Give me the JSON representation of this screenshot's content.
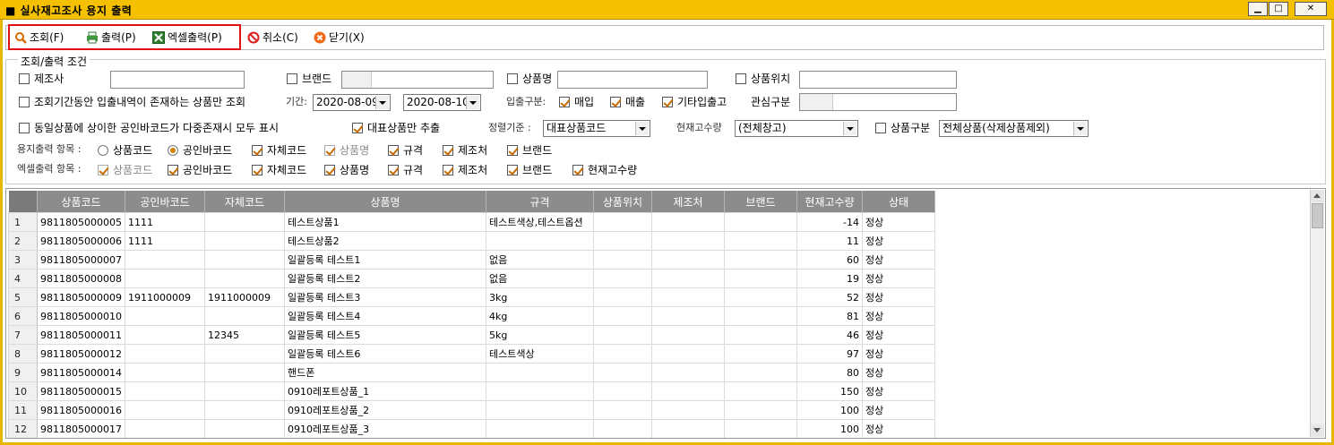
{
  "window": {
    "title": "■ 실사재고조사 용지 출력"
  },
  "toolbar": {
    "search_label": "조회(F)",
    "print_label": "출력(P)",
    "excel_label": "엑셀출력(P)",
    "cancel_label": "취소(C)",
    "close_label": "닫기(X)"
  },
  "conditions": {
    "group_label": "조회/출력 조건",
    "maker_label": "제조사",
    "brand_label": "브랜드",
    "product_name_label": "상품명",
    "product_location_label": "상품위치",
    "only_existing_label": "조회기간동안 입출내역이 존재하는 상품만 조회",
    "period_label": "기간:",
    "date_from": "2020-08-09",
    "date_to": "2020-08-10",
    "inout_label": "입출구분:",
    "inout_purchase": "매입",
    "inout_sales": "매출",
    "inout_other": "기타입출고",
    "interest_label": "관심구분",
    "multi_barcode_label": "동일상품에 상이한 공인바코드가 다중존재시 모두 표시",
    "representative_label": "대표상품만 추출",
    "sort_label": "정렬기준 :",
    "sort_value": "대표상품코드",
    "stock_label": "현재고수량",
    "stock_value": "(전체창고)",
    "category_label": "상품구분",
    "category_value": "전체상품(삭제상품제외)"
  },
  "paper_items": {
    "label": "용지출력 항목 :",
    "product_code": "상품코드",
    "public_barcode": "공인바코드",
    "own_code": "자체코드",
    "product_name": "상품명",
    "spec": "규격",
    "maker": "제조처",
    "brand": "브랜드"
  },
  "excel_items": {
    "label": "엑셀출력 항목 :",
    "product_code": "상품코드",
    "public_barcode": "공인바코드",
    "own_code": "자체코드",
    "product_name": "상품명",
    "spec": "규격",
    "maker": "제조처",
    "brand": "브랜드",
    "current_stock": "현재고수량"
  },
  "grid": {
    "columns": [
      "상품코드",
      "공인바코드",
      "자체코드",
      "상품명",
      "규격",
      "상품위치",
      "제조처",
      "브랜드",
      "현재고수량",
      "상태"
    ],
    "rows": [
      [
        "1",
        "9811805000005",
        "1111",
        "",
        "테스트상품1",
        "테스트색상,테스트옵션",
        "",
        "",
        "",
        "-14",
        "정상"
      ],
      [
        "2",
        "9811805000006",
        "1111",
        "",
        "테스트상품2",
        "",
        "",
        "",
        "",
        "11",
        "정상"
      ],
      [
        "3",
        "9811805000007",
        "",
        "",
        "일괄등록 테스트1",
        "없음",
        "",
        "",
        "",
        "60",
        "정상"
      ],
      [
        "4",
        "9811805000008",
        "",
        "",
        "일괄등록 테스트2",
        "없음",
        "",
        "",
        "",
        "19",
        "정상"
      ],
      [
        "5",
        "9811805000009",
        "1911000009",
        "1911000009",
        "일괄등록 테스트3",
        "3kg",
        "",
        "",
        "",
        "52",
        "정상"
      ],
      [
        "6",
        "9811805000010",
        "",
        "",
        "일괄등록 테스트4",
        "4kg",
        "",
        "",
        "",
        "81",
        "정상"
      ],
      [
        "7",
        "9811805000011",
        "",
        "12345",
        "일괄등록 테스트5",
        "5kg",
        "",
        "",
        "",
        "46",
        "정상"
      ],
      [
        "8",
        "9811805000012",
        "",
        "",
        "일괄등록 테스트6",
        "테스트색상",
        "",
        "",
        "",
        "97",
        "정상"
      ],
      [
        "9",
        "9811805000014",
        "",
        "",
        "핸드폰",
        "",
        "",
        "",
        "",
        "80",
        "정상"
      ],
      [
        "10",
        "9811805000015",
        "",
        "",
        "0910레포트상품_1",
        "",
        "",
        "",
        "",
        "150",
        "정상"
      ],
      [
        "11",
        "9811805000016",
        "",
        "",
        "0910레포트상품_2",
        "",
        "",
        "",
        "",
        "100",
        "정상"
      ],
      [
        "12",
        "9811805000017",
        "",
        "",
        "0910레포트상품_3",
        "",
        "",
        "",
        "",
        "100",
        "정상"
      ]
    ]
  },
  "icons": {
    "search": "magnifier-icon",
    "print": "printer-icon",
    "excel": "excel-icon",
    "cancel": "no-entry-icon",
    "close": "close-circle-icon"
  },
  "colors": {
    "titlebar": "#f5c000",
    "highlight_box": "#e01010",
    "grid_header": "#8c8c8c"
  }
}
